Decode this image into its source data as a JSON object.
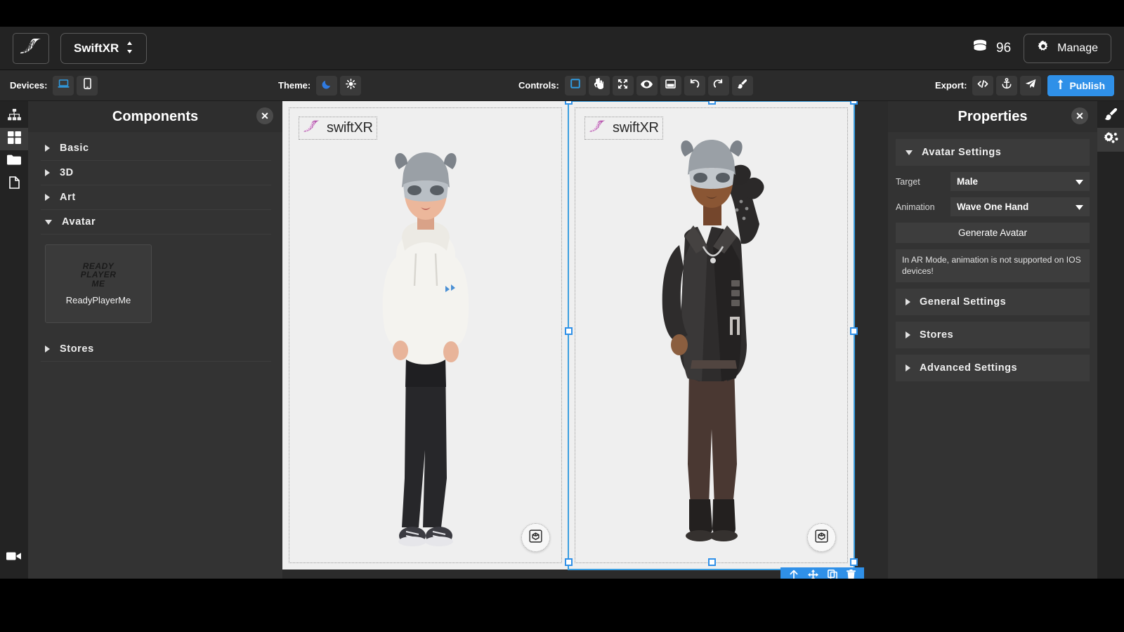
{
  "header": {
    "logo_icon": "swiftxr-wing-logo",
    "project_name": "SwiftXR",
    "project_switch_icon": "up-down-arrows-icon",
    "coins_icon": "coins-stack-icon",
    "coins_count": "96",
    "manage_icon": "gear-icon",
    "manage_label": "Manage"
  },
  "toolbar": {
    "devices_label": "Devices:",
    "devices": [
      {
        "name": "desktop-device",
        "icon": "laptop-icon",
        "active": true
      },
      {
        "name": "mobile-device",
        "icon": "phone-icon",
        "active": false
      }
    ],
    "theme_label": "Theme:",
    "themes": [
      {
        "name": "dark-theme",
        "icon": "moon-icon",
        "active": true
      },
      {
        "name": "light-theme",
        "icon": "sun-icon",
        "active": false
      }
    ],
    "controls_label": "Controls:",
    "controls": [
      {
        "name": "select-tool",
        "icon": "square-select-icon",
        "active": true
      },
      {
        "name": "hand-tool",
        "icon": "hand-pointer-icon",
        "active": false
      },
      {
        "name": "resize-tool",
        "icon": "compress-arrows-icon",
        "active": false
      },
      {
        "name": "preview-tool",
        "icon": "eye-icon",
        "active": false
      },
      {
        "name": "frame-tool",
        "icon": "window-frame-icon",
        "active": false
      },
      {
        "name": "undo",
        "icon": "undo-arrow-icon",
        "active": false
      },
      {
        "name": "redo",
        "icon": "redo-arrow-icon",
        "active": false
      },
      {
        "name": "paint-tool",
        "icon": "brush-icon",
        "active": false
      }
    ],
    "export_label": "Export:",
    "exports": [
      {
        "name": "export-code",
        "icon": "code-brackets-icon"
      },
      {
        "name": "export-anchor",
        "icon": "anchor-icon"
      },
      {
        "name": "export-send",
        "icon": "paper-plane-icon"
      }
    ],
    "publish_icon": "upload-arrow-icon",
    "publish_label": "Publish"
  },
  "left_rail": {
    "items": [
      {
        "name": "sitemap-rail-item",
        "icon": "sitemap-icon",
        "active": false
      },
      {
        "name": "components-rail-item",
        "icon": "grid-squares-icon",
        "active": true
      },
      {
        "name": "assets-rail-item",
        "icon": "folder-icon",
        "active": false
      },
      {
        "name": "pages-rail-item",
        "icon": "document-icon",
        "active": false
      }
    ],
    "bottom": {
      "name": "record-rail-item",
      "icon": "video-camera-icon"
    }
  },
  "components_panel": {
    "title": "Components",
    "close_icon": "close-x-icon",
    "sections": [
      {
        "label": "Basic",
        "expanded": false
      },
      {
        "label": "3D",
        "expanded": false
      },
      {
        "label": "Art",
        "expanded": false
      },
      {
        "label": "Avatar",
        "expanded": true
      },
      {
        "label": "Stores",
        "expanded": false
      }
    ],
    "avatar_items": [
      {
        "label": "ReadyPlayerMe",
        "logo_line1": "READY",
        "logo_line2": "PLAYER",
        "logo_line3": "ME"
      }
    ]
  },
  "canvas": {
    "watermark_text": "swiftXR",
    "watermark_logo_icon": "swiftxr-wing-logo",
    "frames": [
      {
        "name": "frame-left",
        "selected": false,
        "ar_button_icon": "view-in-3d-icon",
        "avatar_label": "female-hoodie-avatar"
      },
      {
        "name": "frame-right",
        "selected": true,
        "ar_button_icon": "view-in-3d-icon",
        "avatar_label": "male-jacket-avatar-waving"
      }
    ],
    "selection_toolbar": [
      {
        "name": "move-up-layer-button",
        "icon": "arrow-up-icon"
      },
      {
        "name": "move-button",
        "icon": "arrows-move-icon"
      },
      {
        "name": "duplicate-button",
        "icon": "copy-icon"
      },
      {
        "name": "delete-button",
        "icon": "trash-icon"
      }
    ]
  },
  "properties_panel": {
    "title": "Properties",
    "close_icon": "close-x-icon",
    "avatar_settings": {
      "label": "Avatar Settings",
      "expanded": true,
      "target_label": "Target",
      "target_value": "Male",
      "animation_label": "Animation",
      "animation_value": "Wave One Hand",
      "generate_label": "Generate Avatar",
      "note": "In AR Mode, animation is not supported on IOS devices!"
    },
    "sections": [
      {
        "label": "General Settings",
        "expanded": false
      },
      {
        "label": "Stores",
        "expanded": false
      },
      {
        "label": "Advanced Settings",
        "expanded": false
      }
    ]
  },
  "right_rail": {
    "items": [
      {
        "name": "style-rail-item",
        "icon": "brush-icon",
        "active": false
      },
      {
        "name": "settings-rail-item",
        "icon": "gears-icon",
        "active": true
      }
    ]
  },
  "colors": {
    "accent_blue": "#2f90e8",
    "panel_bg": "#333333",
    "header_bg": "#232323",
    "toolbar_bg": "#2b2b2b"
  }
}
